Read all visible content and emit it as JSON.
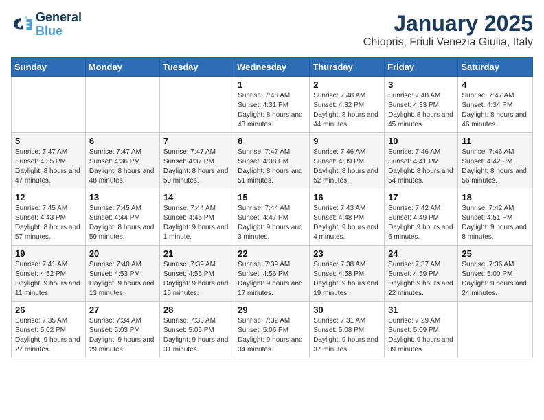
{
  "header": {
    "logo_line1": "General",
    "logo_line2": "Blue",
    "month": "January 2025",
    "location": "Chiopris, Friuli Venezia Giulia, Italy"
  },
  "weekdays": [
    "Sunday",
    "Monday",
    "Tuesday",
    "Wednesday",
    "Thursday",
    "Friday",
    "Saturday"
  ],
  "weeks": [
    [
      {
        "day": "",
        "info": ""
      },
      {
        "day": "",
        "info": ""
      },
      {
        "day": "",
        "info": ""
      },
      {
        "day": "1",
        "info": "Sunrise: 7:48 AM\nSunset: 4:31 PM\nDaylight: 8 hours and 43 minutes."
      },
      {
        "day": "2",
        "info": "Sunrise: 7:48 AM\nSunset: 4:32 PM\nDaylight: 8 hours and 44 minutes."
      },
      {
        "day": "3",
        "info": "Sunrise: 7:48 AM\nSunset: 4:33 PM\nDaylight: 8 hours and 45 minutes."
      },
      {
        "day": "4",
        "info": "Sunrise: 7:47 AM\nSunset: 4:34 PM\nDaylight: 8 hours and 46 minutes."
      }
    ],
    [
      {
        "day": "5",
        "info": "Sunrise: 7:47 AM\nSunset: 4:35 PM\nDaylight: 8 hours and 47 minutes."
      },
      {
        "day": "6",
        "info": "Sunrise: 7:47 AM\nSunset: 4:36 PM\nDaylight: 8 hours and 48 minutes."
      },
      {
        "day": "7",
        "info": "Sunrise: 7:47 AM\nSunset: 4:37 PM\nDaylight: 8 hours and 50 minutes."
      },
      {
        "day": "8",
        "info": "Sunrise: 7:47 AM\nSunset: 4:38 PM\nDaylight: 8 hours and 51 minutes."
      },
      {
        "day": "9",
        "info": "Sunrise: 7:46 AM\nSunset: 4:39 PM\nDaylight: 8 hours and 52 minutes."
      },
      {
        "day": "10",
        "info": "Sunrise: 7:46 AM\nSunset: 4:41 PM\nDaylight: 8 hours and 54 minutes."
      },
      {
        "day": "11",
        "info": "Sunrise: 7:46 AM\nSunset: 4:42 PM\nDaylight: 8 hours and 56 minutes."
      }
    ],
    [
      {
        "day": "12",
        "info": "Sunrise: 7:45 AM\nSunset: 4:43 PM\nDaylight: 8 hours and 57 minutes."
      },
      {
        "day": "13",
        "info": "Sunrise: 7:45 AM\nSunset: 4:44 PM\nDaylight: 8 hours and 59 minutes."
      },
      {
        "day": "14",
        "info": "Sunrise: 7:44 AM\nSunset: 4:45 PM\nDaylight: 9 hours and 1 minute."
      },
      {
        "day": "15",
        "info": "Sunrise: 7:44 AM\nSunset: 4:47 PM\nDaylight: 9 hours and 3 minutes."
      },
      {
        "day": "16",
        "info": "Sunrise: 7:43 AM\nSunset: 4:48 PM\nDaylight: 9 hours and 4 minutes."
      },
      {
        "day": "17",
        "info": "Sunrise: 7:42 AM\nSunset: 4:49 PM\nDaylight: 9 hours and 6 minutes."
      },
      {
        "day": "18",
        "info": "Sunrise: 7:42 AM\nSunset: 4:51 PM\nDaylight: 9 hours and 8 minutes."
      }
    ],
    [
      {
        "day": "19",
        "info": "Sunrise: 7:41 AM\nSunset: 4:52 PM\nDaylight: 9 hours and 11 minutes."
      },
      {
        "day": "20",
        "info": "Sunrise: 7:40 AM\nSunset: 4:53 PM\nDaylight: 9 hours and 13 minutes."
      },
      {
        "day": "21",
        "info": "Sunrise: 7:39 AM\nSunset: 4:55 PM\nDaylight: 9 hours and 15 minutes."
      },
      {
        "day": "22",
        "info": "Sunrise: 7:39 AM\nSunset: 4:56 PM\nDaylight: 9 hours and 17 minutes."
      },
      {
        "day": "23",
        "info": "Sunrise: 7:38 AM\nSunset: 4:58 PM\nDaylight: 9 hours and 19 minutes."
      },
      {
        "day": "24",
        "info": "Sunrise: 7:37 AM\nSunset: 4:59 PM\nDaylight: 9 hours and 22 minutes."
      },
      {
        "day": "25",
        "info": "Sunrise: 7:36 AM\nSunset: 5:00 PM\nDaylight: 9 hours and 24 minutes."
      }
    ],
    [
      {
        "day": "26",
        "info": "Sunrise: 7:35 AM\nSunset: 5:02 PM\nDaylight: 9 hours and 27 minutes."
      },
      {
        "day": "27",
        "info": "Sunrise: 7:34 AM\nSunset: 5:03 PM\nDaylight: 9 hours and 29 minutes."
      },
      {
        "day": "28",
        "info": "Sunrise: 7:33 AM\nSunset: 5:05 PM\nDaylight: 9 hours and 31 minutes."
      },
      {
        "day": "29",
        "info": "Sunrise: 7:32 AM\nSunset: 5:06 PM\nDaylight: 9 hours and 34 minutes."
      },
      {
        "day": "30",
        "info": "Sunrise: 7:31 AM\nSunset: 5:08 PM\nDaylight: 9 hours and 37 minutes."
      },
      {
        "day": "31",
        "info": "Sunrise: 7:29 AM\nSunset: 5:09 PM\nDaylight: 9 hours and 39 minutes."
      },
      {
        "day": "",
        "info": ""
      }
    ]
  ]
}
